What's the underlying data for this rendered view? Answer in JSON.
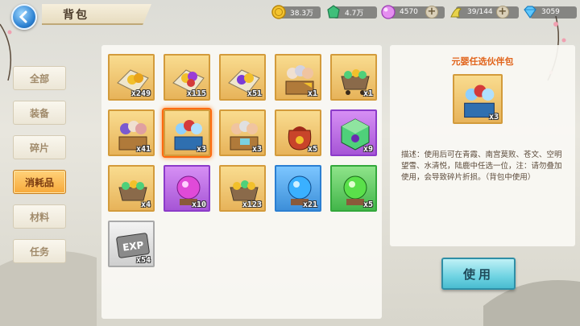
{
  "header": {
    "title": "背包"
  },
  "resources": [
    {
      "icon": "gold-coin-icon",
      "value": "38.3万"
    },
    {
      "icon": "green-gem-icon",
      "value": "4.7万"
    },
    {
      "icon": "pink-orb-icon",
      "value": "4570"
    },
    {
      "icon": "stamina-icon",
      "value": "39/144"
    },
    {
      "icon": "diamond-icon",
      "value": "3059"
    }
  ],
  "tabs": [
    {
      "label": "全部",
      "active": false
    },
    {
      "label": "装备",
      "active": false
    },
    {
      "label": "碎片",
      "active": false
    },
    {
      "label": "消耗品",
      "active": true
    },
    {
      "label": "材料",
      "active": false
    },
    {
      "label": "任务",
      "active": false
    }
  ],
  "items": [
    {
      "name": "gold-orbs-scroll",
      "count": "x249",
      "frame": "gold"
    },
    {
      "name": "purple-orbs-scroll",
      "count": "x115",
      "frame": "gold"
    },
    {
      "name": "red-orbs-scroll",
      "count": "x51",
      "frame": "gold"
    },
    {
      "name": "hero-pack",
      "count": "x1",
      "frame": "gold"
    },
    {
      "name": "gem-cart",
      "count": "x1",
      "frame": "gold"
    },
    {
      "name": "hero-pack-2",
      "count": "x41",
      "frame": "gold"
    },
    {
      "name": "hero-pack-blue",
      "count": "x3",
      "frame": "gold",
      "selected": true
    },
    {
      "name": "hero-pack-3",
      "count": "x3",
      "frame": "gold"
    },
    {
      "name": "lucky-bag",
      "count": "x5",
      "frame": "gold"
    },
    {
      "name": "mystery-cube",
      "count": "x9",
      "frame": "purple"
    },
    {
      "name": "gem-cart-2",
      "count": "x4",
      "frame": "gold"
    },
    {
      "name": "purple-crystal",
      "count": "x10",
      "frame": "purple"
    },
    {
      "name": "gem-cart-3",
      "count": "x123",
      "frame": "gold"
    },
    {
      "name": "blue-crystal",
      "count": "x21",
      "frame": "blue"
    },
    {
      "name": "green-crystal",
      "count": "x5",
      "frame": "green"
    },
    {
      "name": "exp-vip-card",
      "count": "x54",
      "frame": "gray",
      "text": "EXP"
    }
  ],
  "detail": {
    "name": "元婴任选伙伴包",
    "count": "x3",
    "description": "描述：使用后可在青霞、南宫莫败、苍文、空明望雪、水清悦，陆鹿中任选一位，注：请勿叠加使用，会导致碎片折损。（背包中使用）",
    "use_label": "使用"
  }
}
